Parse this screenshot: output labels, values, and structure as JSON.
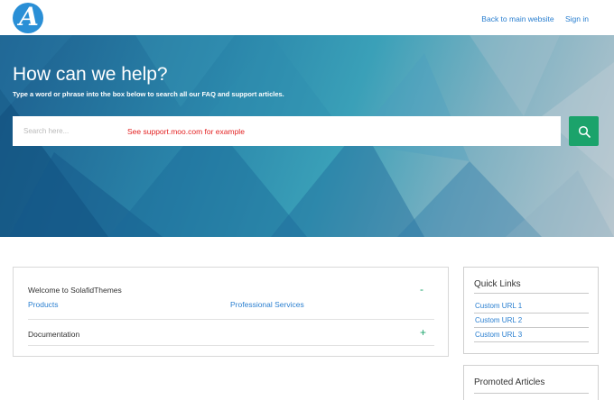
{
  "header": {
    "logo_letter": "A",
    "links": [
      "Back to main website",
      "Sign in"
    ]
  },
  "hero": {
    "title": "How can we help?",
    "subtitle": "Type a word or phrase into the box below to search all our FAQ and support articles.",
    "search_placeholder": "Search here...",
    "search_note": "See support.moo.com for example",
    "search_icon": "search-icon"
  },
  "categories": {
    "sections": [
      {
        "title": "Welcome to SolafidThemes",
        "toggle": "-",
        "links": [
          "Products",
          "Professional Services"
        ]
      },
      {
        "title": "Documentation",
        "toggle": "+"
      }
    ]
  },
  "sidebar": {
    "quick_links": {
      "title": "Quick Links",
      "items": [
        "Custom URL 1",
        "Custom URL 2",
        "Custom URL 3"
      ]
    },
    "promoted": {
      "title": "Promoted Articles"
    }
  },
  "colors": {
    "accent": "#1ba36b",
    "link": "#2a7fd0",
    "note": "#e32222"
  }
}
